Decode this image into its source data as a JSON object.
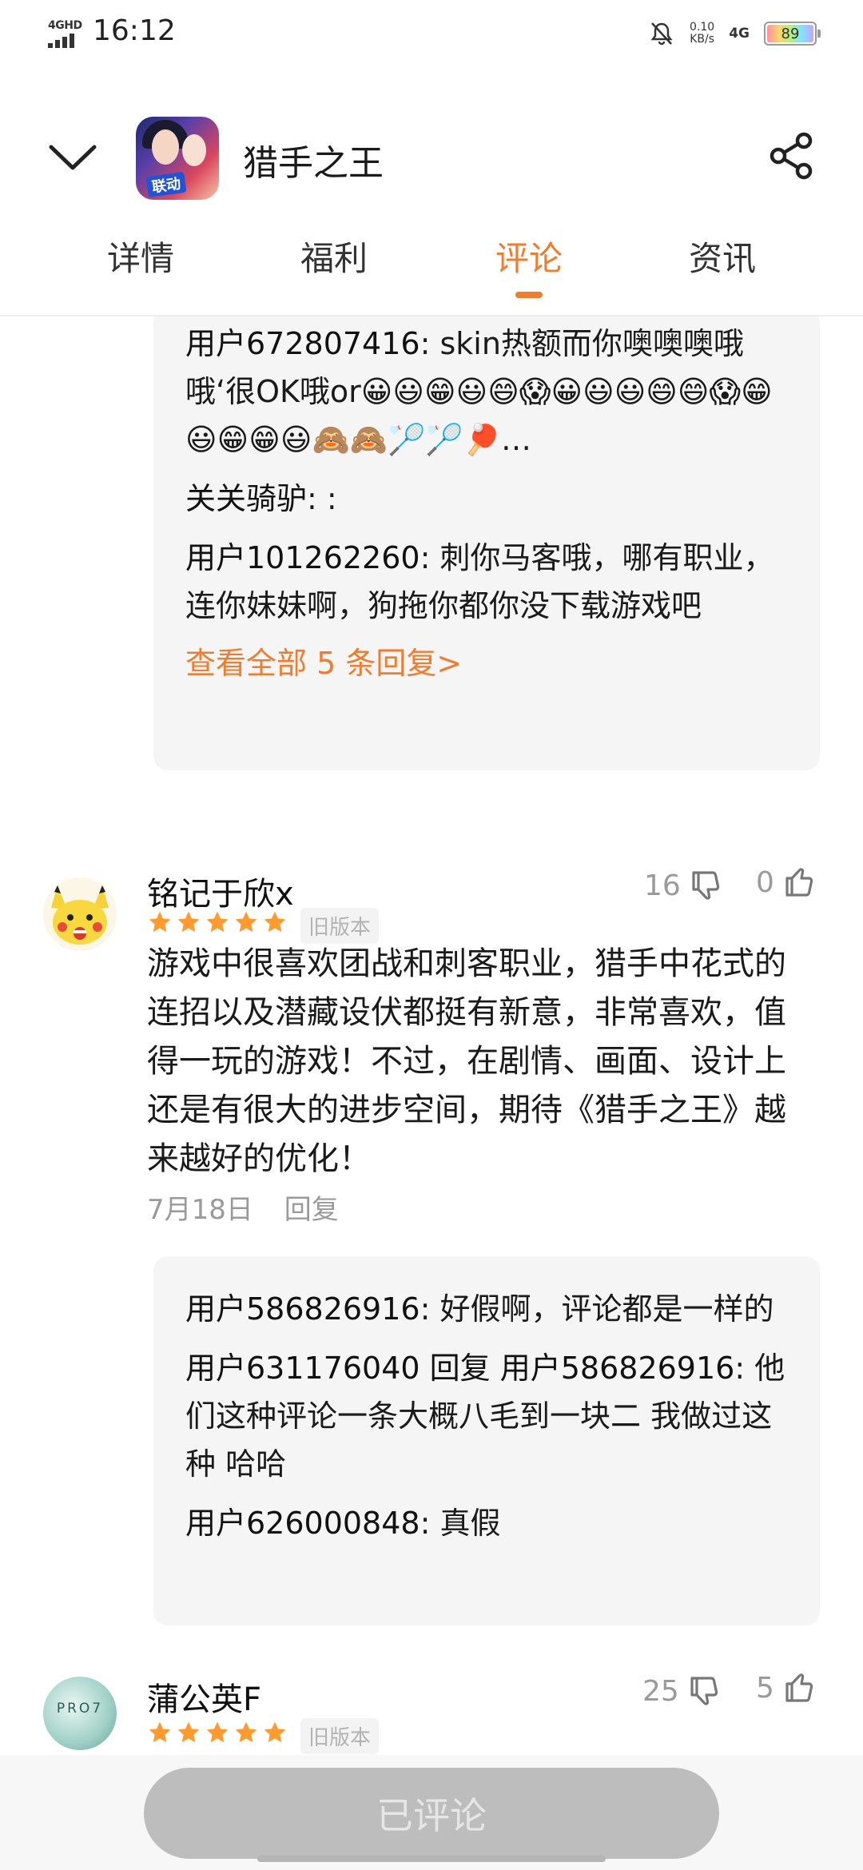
{
  "status_bar": {
    "network": "4GHD",
    "time": "16:12",
    "speed_value": "0.10",
    "speed_unit": "KB/s",
    "net_type": "4G",
    "battery": "89"
  },
  "header": {
    "title": "猎手之王",
    "icon_badge": "联动"
  },
  "tabs": [
    {
      "label": "详情"
    },
    {
      "label": "福利"
    },
    {
      "label": "评论"
    },
    {
      "label": "资讯"
    }
  ],
  "reply_thread_top": {
    "replies": [
      {
        "author": "用户672807416",
        "text": ": skin热额而你噢噢噢哦哦‘很OK哦or😀😃😁😃😄😱😀😃😃😄😄😱😁😃😁😁😃🙈🙈🏸🏸🏓…"
      },
      {
        "author": "关关骑驴",
        "text": ": :"
      },
      {
        "author": "用户101262260",
        "text": ": 刺你马客哦，哪有职业，连你妹妹啊，狗拖你都你没下载游戏吧"
      }
    ],
    "more_label": "查看全部 5 条回复>"
  },
  "comments": [
    {
      "name": "铭记于欣x",
      "tag": "旧版本",
      "dislikes": "16",
      "likes": "0",
      "text": "游戏中很喜欢团战和刺客职业，猎手中花式的连招以及潜藏设伏都挺有新意，非常喜欢，值得一玩的游戏！不过，在剧情、画面、设计上还是有很大的进步空间，期待《猎手之王》越来越好的优化！",
      "date": "7月18日",
      "reply_label": "回复",
      "replies": [
        {
          "author": "用户586826916",
          "text": ": 好假啊，评论都是一样的"
        },
        {
          "author": "用户631176040 回复 用户586826916",
          "text": ": 他们这种评论一条大概八毛到一块二 我做过这种 哈哈"
        },
        {
          "author": "用户626000848",
          "text": ": 真假"
        }
      ]
    },
    {
      "name": "蒲公英F",
      "tag": "旧版本",
      "dislikes": "25",
      "likes": "5",
      "avatar_text": "PRO7"
    }
  ],
  "bottom": {
    "button_label": "已评论"
  },
  "colors": {
    "accent": "#f37b2c",
    "star": "#ff9a2e"
  }
}
